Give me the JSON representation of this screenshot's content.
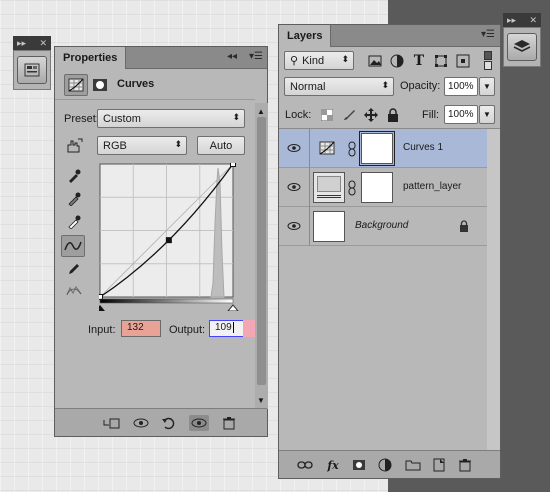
{
  "properties": {
    "tab_label": "Properties",
    "adjustment_title": "Curves",
    "preset_label": "Preset:",
    "preset_value": "Custom",
    "channel_value": "RGB",
    "auto_label": "Auto",
    "input_label": "Input:",
    "input_value": "132",
    "output_label": "Output:",
    "output_value": "109"
  },
  "layers": {
    "tab_label": "Layers",
    "kind_value": "Kind",
    "blend_mode": "Normal",
    "opacity_label": "Opacity:",
    "opacity_value": "100%",
    "lock_label": "Lock:",
    "fill_label": "Fill:",
    "fill_value": "100%",
    "items": [
      {
        "name": "Curves 1"
      },
      {
        "name": "pattern_layer"
      },
      {
        "name": "Background"
      }
    ]
  },
  "curve": {
    "points": [
      [
        0,
        0
      ],
      [
        132,
        109
      ],
      [
        255,
        255
      ]
    ]
  },
  "colors": {
    "panel_bg": "#b8b8b8",
    "selected_layer": "#a9b8d6",
    "input_highlight": "#e9a296"
  },
  "icons": [
    "collapse-icon",
    "close-icon",
    "menu-icon",
    "curves-icon",
    "mask-icon",
    "hand-target-icon",
    "eyedropper-icon",
    "curve-edit-icon",
    "pencil-icon",
    "smooth-icon",
    "eye-icon",
    "link-icon",
    "lock-icon",
    "fx-icon",
    "trash-icon"
  ]
}
